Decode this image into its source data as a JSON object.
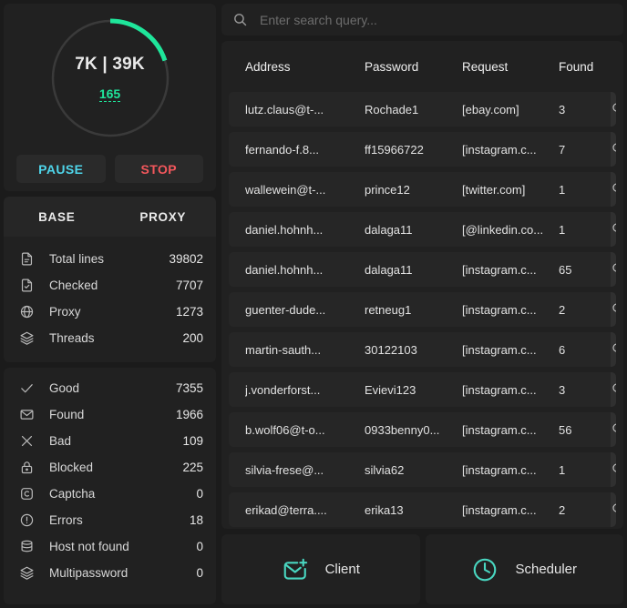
{
  "progress": {
    "main_value": "7K | 39K",
    "sub_value": "165",
    "percent": 20,
    "arc_color": "#1fe69b",
    "track_color": "#3a3a3a",
    "pause_label": "PAUSE",
    "stop_label": "STOP",
    "pause_color": "#4fd5ea",
    "stop_color": "#f2575c"
  },
  "tabs": {
    "base_label": "BASE",
    "proxy_label": "PROXY"
  },
  "base_stats": [
    {
      "icon": "file-icon",
      "label": "Total lines",
      "value": "39802"
    },
    {
      "icon": "file-check-icon",
      "label": "Checked",
      "value": "7707"
    },
    {
      "icon": "globe-icon",
      "label": "Proxy",
      "value": "1273"
    },
    {
      "icon": "layers-icon",
      "label": "Threads",
      "value": "200"
    }
  ],
  "counters": [
    {
      "icon": "check-icon",
      "label": "Good",
      "value": "7355"
    },
    {
      "icon": "envelope-icon",
      "label": "Found",
      "value": "1966"
    },
    {
      "icon": "close-icon",
      "label": "Bad",
      "value": "109"
    },
    {
      "icon": "lock-icon",
      "label": "Blocked",
      "value": "225"
    },
    {
      "icon": "captcha-icon",
      "label": "Captcha",
      "value": "0"
    },
    {
      "icon": "warning-icon",
      "label": "Errors",
      "value": "18"
    },
    {
      "icon": "database-icon",
      "label": "Host not found",
      "value": "0"
    },
    {
      "icon": "layers-icon",
      "label": "Multipassword",
      "value": "0"
    }
  ],
  "search": {
    "placeholder": "Enter search query...",
    "value": ""
  },
  "table": {
    "columns": [
      "Address",
      "Password",
      "Request",
      "Found"
    ],
    "rows": [
      {
        "address": "lutz.claus@t-...",
        "password": "Rochade1",
        "request": "[ebay.com]",
        "found": "3"
      },
      {
        "address": "fernando-f.8...",
        "password": "ff15966722",
        "request": "[instagram.c...",
        "found": "7"
      },
      {
        "address": "wallewein@t-...",
        "password": "prince12",
        "request": "[twitter.com]",
        "found": "1"
      },
      {
        "address": "daniel.hohnh...",
        "password": "dalaga11",
        "request": "[@linkedin.co...",
        "found": "1"
      },
      {
        "address": "daniel.hohnh...",
        "password": "dalaga11",
        "request": "[instagram.c...",
        "found": "65"
      },
      {
        "address": "guenter-dude...",
        "password": "retneug1",
        "request": "[instagram.c...",
        "found": "2"
      },
      {
        "address": "martin-sauth...",
        "password": "30122103",
        "request": "[instagram.c...",
        "found": "6"
      },
      {
        "address": "j.vonderforst...",
        "password": "Evievi123",
        "request": "[instagram.c...",
        "found": "3"
      },
      {
        "address": "b.wolf06@t-o...",
        "password": "0933benny0...",
        "request": "[instagram.c...",
        "found": "56"
      },
      {
        "address": "silvia-frese@...",
        "password": "silvia62",
        "request": "[instagram.c...",
        "found": "1"
      },
      {
        "address": "erikad@terra....",
        "password": "erika13",
        "request": "[instagram.c...",
        "found": "2"
      }
    ],
    "row_action_icon": "search-icon"
  },
  "bottom_buttons": [
    {
      "icon": "mail-add-icon",
      "label": "Client"
    },
    {
      "icon": "clock-icon",
      "label": "Scheduler"
    }
  ]
}
